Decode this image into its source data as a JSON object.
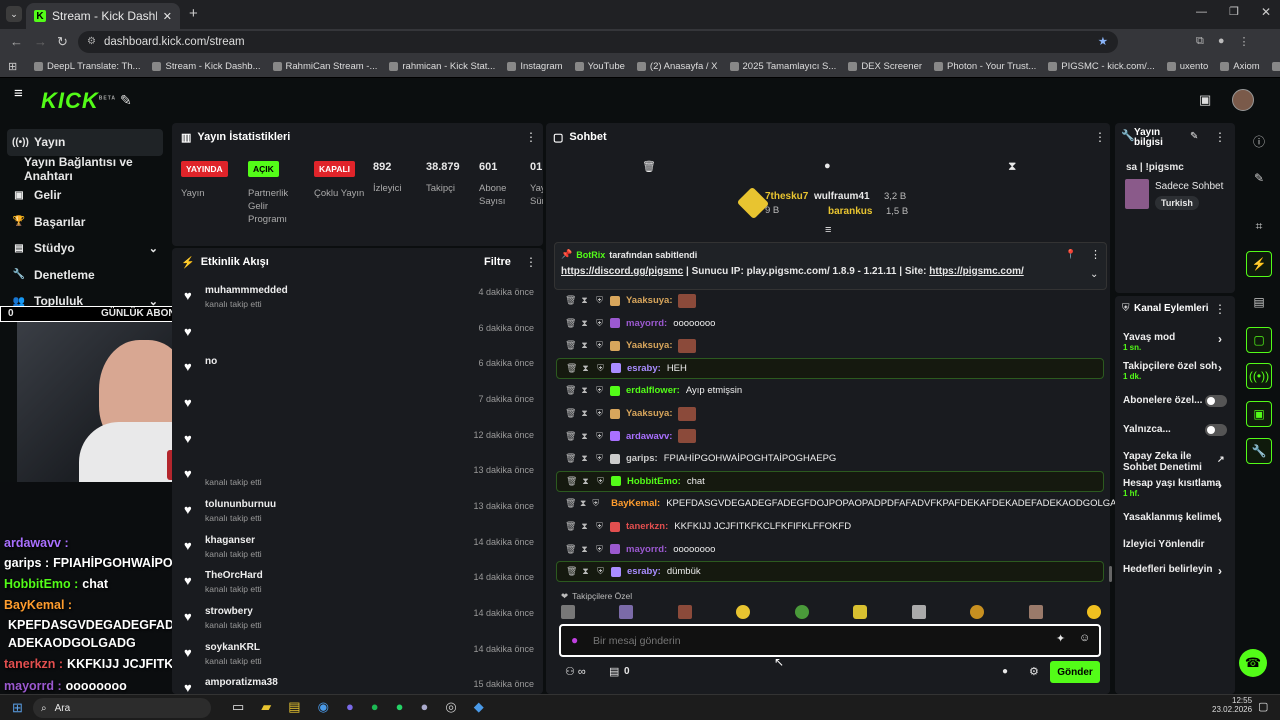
{
  "browser": {
    "tab_title": "Stream - Kick Dashboard",
    "url": "dashboard.kick.com/stream",
    "bookmarks": [
      "DeepL Translate: Th...",
      "Stream - Kick Dashb...",
      "RahmiCan Stream -...",
      "rahmican - Kick Stat...",
      "Instagram",
      "YouTube",
      "(2) Anasayfa / X",
      "2025 Tamamlayıcı S...",
      "DEX Screener",
      "Photon - Your Trust...",
      "PIGSMC - kick.com/...",
      "uxento",
      "Axiom",
      "Zonguldak İngilizce..."
    ]
  },
  "header": {
    "logo": "KICK",
    "beta": "BETA"
  },
  "nav": {
    "items": [
      "Yayın",
      "Yayın Bağlantısı ve Anahtarı",
      "Gelir",
      "Başarılar",
      "Stüdyo",
      "Denetleme",
      "Topluluk"
    ]
  },
  "overlay": {
    "goal_left": "0",
    "goal_label": "GÜNLÜK ABONE",
    "goal_right": "5"
  },
  "stats": {
    "title": "Yayın İstatistikleri",
    "badges": [
      {
        "badge": "YAYINDA",
        "label": "Yayın"
      },
      {
        "badge": "AÇIK",
        "label": "Partnerlik Gelir Programı"
      },
      {
        "badge": "KAPALI",
        "label": "Çoklu Yayın"
      }
    ],
    "numbers": [
      {
        "value": "892",
        "label": "İzleyici"
      },
      {
        "value": "38.879",
        "label": "Takipçi"
      },
      {
        "value": "601",
        "label": "Abone Sayısı"
      },
      {
        "value": "01:",
        "label": "Yay Old Sür"
      }
    ]
  },
  "activity": {
    "title": "Etkinlik Akışı",
    "filter": "Filtre",
    "items": [
      {
        "name": "muhammmedded",
        "sub": "kanalı takip etti",
        "time": "4 dakika önce"
      },
      {
        "name": "",
        "sub": "",
        "time": "6 dakika önce"
      },
      {
        "name": "no",
        "sub": "",
        "time": "6 dakika önce"
      },
      {
        "name": "",
        "sub": "",
        "time": "7 dakika önce"
      },
      {
        "name": "",
        "sub": "",
        "time": "12 dakika önce"
      },
      {
        "name": "",
        "sub": "kanalı takip etti",
        "time": "13 dakika önce"
      },
      {
        "name": "tolununburnuu",
        "sub": "kanalı takip etti",
        "time": "13 dakika önce"
      },
      {
        "name": "khaganser",
        "sub": "kanalı takip etti",
        "time": "14 dakika önce"
      },
      {
        "name": "TheOrcHard",
        "sub": "kanalı takip etti",
        "time": "14 dakika önce"
      },
      {
        "name": "strowbery",
        "sub": "kanalı takip etti",
        "time": "14 dakika önce"
      },
      {
        "name": "soykanKRL",
        "sub": "kanalı takip etti",
        "time": "14 dakika önce"
      },
      {
        "name": "amporatizma38",
        "sub": "",
        "time": "15 dakika önce"
      }
    ]
  },
  "chat": {
    "title": "Sohbet",
    "leaders": [
      {
        "name": "7thesku7",
        "amount": "9 B"
      },
      {
        "name": "wulfraum41",
        "amount": "3,2 B"
      },
      {
        "name": "barankus",
        "amount": "1,5 B"
      }
    ],
    "pinned": {
      "by": "BotRix",
      "by_suffix": "tarafından sabitlendi",
      "link1": "https://discord.gg/pigsmc",
      "text": " | Sunucu IP: play.pigsmc.com/ 1.8.9 - 1.21.11 | Site: ",
      "link2": "https://pigsmc.com/"
    },
    "messages": [
      {
        "user": "Yaaksuya:",
        "color": "#d8a65c",
        "text": "",
        "highlight": false
      },
      {
        "user": "mayorrd:",
        "color": "#9b59d0",
        "text": "oooooooo",
        "highlight": false
      },
      {
        "user": "Yaaksuya:",
        "color": "#d8a65c",
        "text": "",
        "highlight": false
      },
      {
        "user": "esraby:",
        "color": "#a98dff",
        "text": "HEH",
        "highlight": true
      },
      {
        "user": "erdalflower:",
        "color": "#53fc18",
        "text": "Ayıp etmişsin",
        "highlight": false
      },
      {
        "user": "Yaaksuya:",
        "color": "#d8a65c",
        "text": "",
        "highlight": false
      },
      {
        "user": "ardawavv:",
        "color": "#a970ff",
        "text": "",
        "highlight": false
      },
      {
        "user": "garips:",
        "color": "#cccccc",
        "text": "FPIAHİPGOHWAİPOGHTAİPOGHAEPG",
        "highlight": false
      },
      {
        "user": "HobbitEmo:",
        "color": "#53fc18",
        "text": "chat",
        "highlight": true
      },
      {
        "user": "BayKemal:",
        "color": "#ff9d2e",
        "text": "KPEFDASGVDEGADEGFADEGFDOJPOPAOPADPDFAFADVFKPAFDEKAFDEKADEFADEKAODGOLGADG",
        "highlight": false
      },
      {
        "user": "tanerkzn:",
        "color": "#e24f4f",
        "text": "KKFKIJJ JCJFITKFKCLFKFIFKLFFOKFD",
        "highlight": false
      },
      {
        "user": "mayorrd:",
        "color": "#9b59d0",
        "text": "oooooooo",
        "highlight": false
      },
      {
        "user": "esraby:",
        "color": "#a98dff",
        "text": "dümbük",
        "highlight": true
      }
    ],
    "followers_only": "Takipçilere Özel",
    "input_placeholder": "Bir mesaj gönderin",
    "count": "0",
    "send": "Gönder"
  },
  "overlay_chat": [
    {
      "user": "ardawavv :",
      "color": "#a970ff",
      "text": ""
    },
    {
      "user": "garips :",
      "color": "#ffffff",
      "text": "FPIAHİPGOHWAİPOGHTAİPOGHAEPG"
    },
    {
      "user": "HobbitEmo :",
      "color": "#53fc18",
      "text": "chat"
    },
    {
      "user": "BayKemal :",
      "color": "#ff9d2e",
      "text": ""
    },
    {
      "user": "",
      "color": "#ffffff",
      "text": "KPEFDASGVDEGADEGFADEGFDOJPOPAOPADPDFAFADVFKPAFDEKAFDEKADEF"
    },
    {
      "user": "",
      "color": "#ffffff",
      "text": "ADEKAODGOLGADG"
    },
    {
      "user": "tanerkzn :",
      "color": "#e24f4f",
      "text": "KKFKIJJ JCJFITKFKCLFKFIFKLFFOKFD"
    },
    {
      "user": "mayorrd :",
      "color": "#9b59d0",
      "text": "oooooooo"
    }
  ],
  "info": {
    "title": "Yayın bilgisi",
    "stream_title": "sa | !pigsmc",
    "chat_mode": "Sadece Sohbet",
    "language": "Turkish"
  },
  "channel_actions": {
    "title": "Kanal Eylemleri",
    "items": [
      {
        "label": "Yavaş mod",
        "sub": "1 sn."
      },
      {
        "label": "Takipçilere özel soh",
        "sub": "1 dk."
      },
      {
        "label": "Abonelere özel...",
        "sub": ""
      },
      {
        "label": "Yalnızca...",
        "sub": ""
      },
      {
        "label": "Yapay Zeka ile Sohbet Denetimi",
        "sub": ""
      },
      {
        "label": "Hesap yaşı kısıtlama",
        "sub": "1 hf."
      },
      {
        "label": "Yasaklanmış kelimel",
        "sub": ""
      },
      {
        "label": "İzleyici Yönlendir",
        "sub": ""
      },
      {
        "label": "Hedefleri belirleyin",
        "sub": ""
      }
    ]
  },
  "taskbar": {
    "search": "Ara",
    "time": "12:55",
    "date": "23.02.2026"
  },
  "colors": {
    "kick_green": "#53fc18",
    "panel": "#191b1f",
    "bg": "#0b0e0f"
  }
}
